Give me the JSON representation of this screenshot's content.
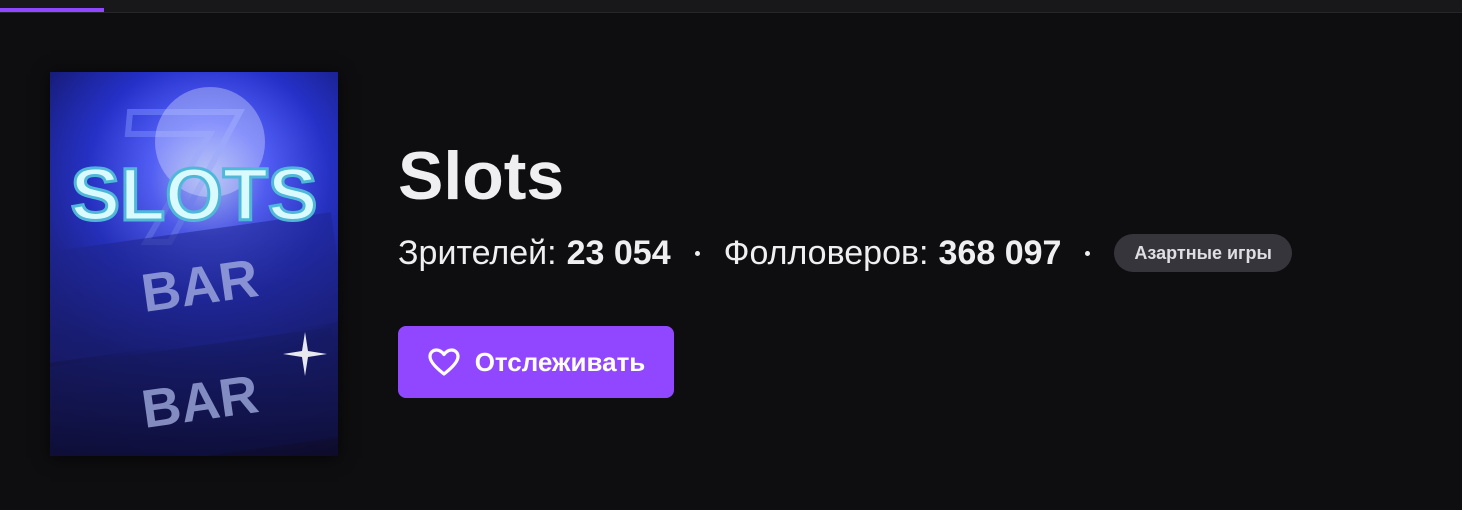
{
  "category": {
    "title": "Slots",
    "cover": {
      "alt": "Slots",
      "art_lines": [
        "SLOTS",
        "BAR",
        "BAR"
      ]
    },
    "viewers_label": "Зрителей:",
    "viewers_count": "23 054",
    "followers_label": "Фолловеров:",
    "followers_count": "368 097",
    "tag": "Азартные игры",
    "follow_label": "Отслеживать",
    "follow_icon": "heart-icon"
  },
  "colors": {
    "accent": "#9147ff",
    "background": "#0e0e10",
    "tag_background": "#35353b"
  },
  "progress": 0.07
}
